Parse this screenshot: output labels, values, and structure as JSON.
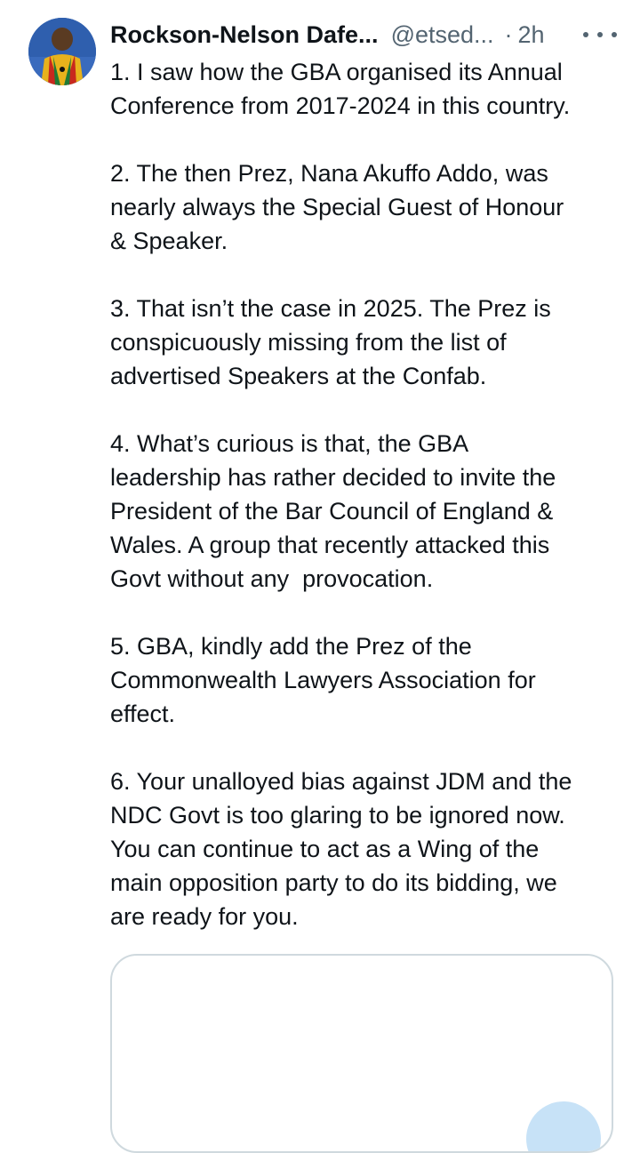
{
  "author": {
    "display_name": "Rockson-Nelson Dafe...",
    "handle": "@etsed...",
    "separator": "·",
    "time": "2h"
  },
  "tweet": {
    "paragraphs": [
      "1. I saw how the GBA organised its Annual\nConference from 2017-2024 in this country.",
      "2. The then Prez, Nana Akuffo Addo, was\nnearly always the Special Guest of Honour\n& Speaker.",
      "3. That isn’t the case in 2025. The Prez is\nconspicuously missing from the list of\nadvertised Speakers at the Confab.",
      "4. What’s curious is that, the GBA\nleadership has rather decided to invite the\nPresident of the Bar Council of England &\nWales. A group that recently attacked this\nGovt without any  provocation.",
      "5. GBA, kindly add the Prez of the\nCommonwealth Lawyers Association for\neffect.",
      "6. Your unalloyed bias against JDM and the\nNDC Govt is too glaring to be ignored now.\nYou can continue to act as a Wing of the\nmain opposition party to do its bidding, we\nare ready for you."
    ]
  },
  "icons": {
    "more": "more-horizontal-icon"
  },
  "colors": {
    "text": "#0f1419",
    "secondary": "#536471",
    "border": "#cfd9de",
    "media_accent": "#c7e2f7"
  }
}
